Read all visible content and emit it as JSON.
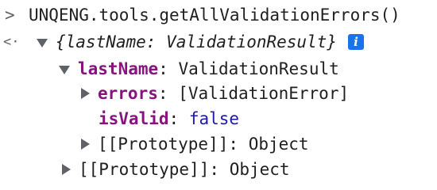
{
  "console": {
    "input_prompt": ">",
    "output_prompt": "<·",
    "command": "UNQENG.tools.getAllValidationErrors()",
    "result_summary": "{lastName: ValidationResult}",
    "info_badge": "i",
    "tree": {
      "last_name": {
        "key": "lastName",
        "value": "ValidationResult"
      },
      "errors": {
        "key": "errors",
        "value": "[ValidationError]"
      },
      "is_valid": {
        "key": "isValid",
        "value": "false"
      },
      "inner_prototype": {
        "key": "[[Prototype]]",
        "value": "Object"
      },
      "outer_prototype": {
        "key": "[[Prototype]]",
        "value": "Object"
      }
    },
    "colon": ":",
    "colors": {
      "key": "#881280",
      "keyword": "#1a1aa6",
      "text": "#1f1f1f",
      "muted": "#5f6368",
      "info_badge": "#1a73e8"
    },
    "icons": {
      "expanded": "triangle-down-icon",
      "collapsed": "triangle-right-icon",
      "info": "info-icon"
    }
  }
}
